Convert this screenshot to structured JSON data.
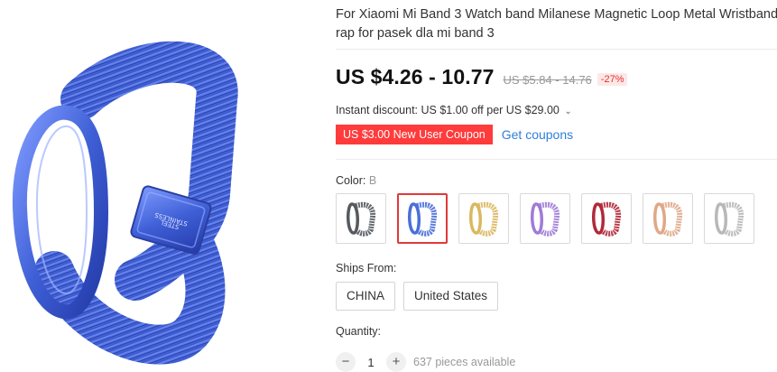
{
  "product": {
    "title_line1": "For Xiaomi Mi Band 3 Watch band Milanese Magnetic Loop Metal Wristband S",
    "title_line2": "rap for pasek dla mi band 3",
    "image_engraving": "STAINLESS STEEL"
  },
  "price": {
    "current": "US $4.26 - 10.77",
    "original": "US $5.84 - 14.76",
    "discount": "-27%"
  },
  "promo": {
    "instant_discount": "Instant discount: US $1.00 off per US $29.00",
    "chevron_icon": "chevron-down-icon",
    "coupon_badge": "US $3.00 New User Coupon",
    "get_coupons": "Get coupons"
  },
  "color": {
    "label": "Color:",
    "selected_value": "B",
    "swatches": [
      {
        "name": "black",
        "color": "#555a60",
        "selected": false
      },
      {
        "name": "blue",
        "color": "#4a6fd8",
        "selected": true
      },
      {
        "name": "gold",
        "color": "#d9b860",
        "selected": false
      },
      {
        "name": "purple",
        "color": "#a07bd6",
        "selected": false
      },
      {
        "name": "red",
        "color": "#b0293a",
        "selected": false
      },
      {
        "name": "rose-gold",
        "color": "#e0a888",
        "selected": false
      },
      {
        "name": "silver",
        "color": "#b8b8b8",
        "selected": false
      }
    ]
  },
  "ships_from": {
    "label": "Ships From:",
    "options": [
      "CHINA",
      "United States"
    ]
  },
  "quantity": {
    "label": "Quantity:",
    "minus": "−",
    "value": "1",
    "plus": "+",
    "available": "637 pieces available"
  },
  "colors": {
    "coupon_red": "#ff3b3b",
    "link_blue": "#2e7fd9",
    "selected_border": "#e03a3a",
    "band_blue": "#4a6fd8"
  }
}
